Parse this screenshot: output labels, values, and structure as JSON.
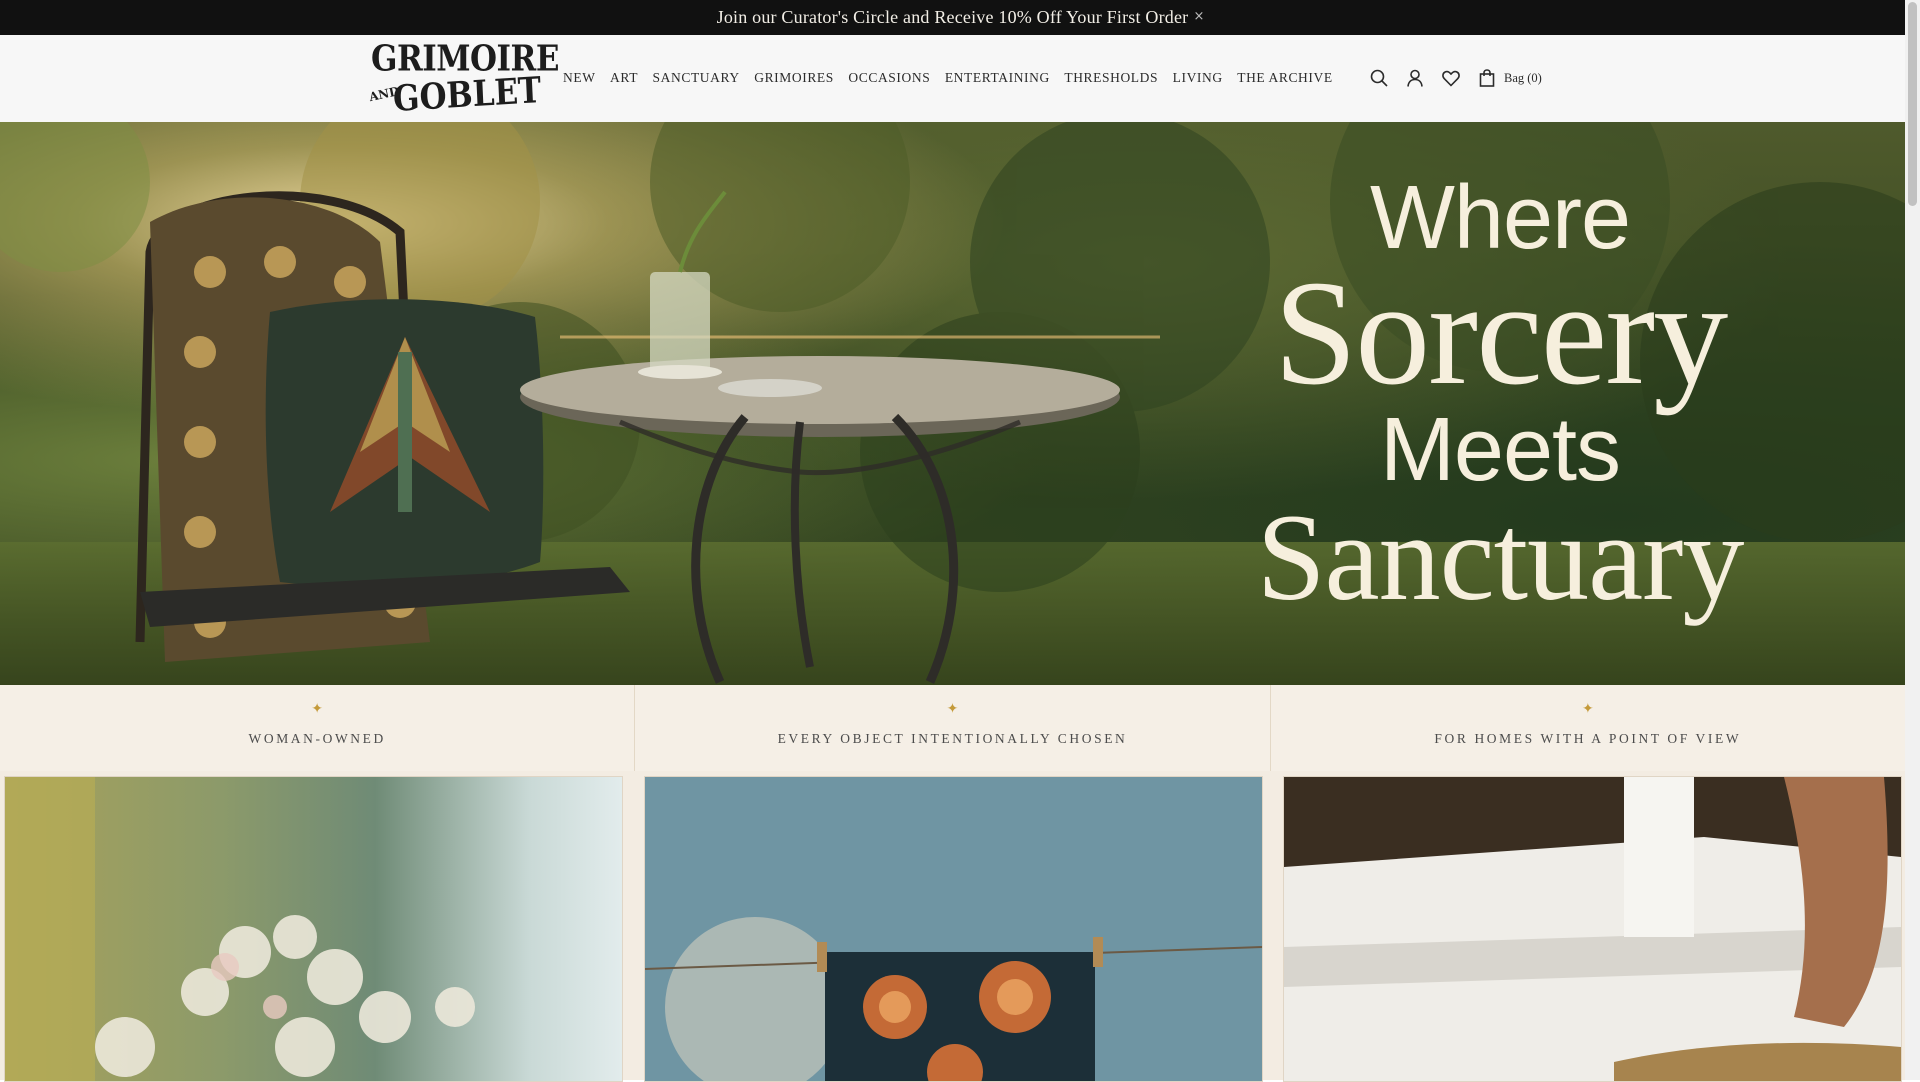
{
  "announcement": {
    "text": "Join our Curator's Circle and Receive 10% Off Your First Order",
    "close_symbol": "×"
  },
  "brand": {
    "line1": "GRIMOIRE",
    "and": "AND",
    "line2": "GOBLET"
  },
  "nav": {
    "items": [
      "NEW",
      "ART",
      "SANCTUARY",
      "GRIMOIRES",
      "OCCASIONS",
      "ENTERTAINING",
      "THRESHOLDS",
      "LIVING",
      "THE ARCHIVE"
    ]
  },
  "header_icons": [
    "search-icon",
    "account-icon",
    "wishlist-heart-icon",
    "bag-icon"
  ],
  "bag": {
    "label": "Bag (0)"
  },
  "hero": {
    "line1": "Where",
    "line2": "Sorcery",
    "line3": "Meets",
    "line4": "Sanctuary"
  },
  "values": [
    {
      "icon": "✦",
      "text": "WOMAN-OWNED"
    },
    {
      "icon": "✦",
      "text": "EVERY OBJECT INTENTIONALLY CHOSEN"
    },
    {
      "icon": "✦",
      "text": "FOR HOMES WITH A POINT OF VIEW"
    }
  ],
  "colors": {
    "announcement_bg": "#111111",
    "header_bg": "#f7f7f7",
    "values_bg": "#f5efe6",
    "accent_gold": "#c49a3a",
    "hero_text": "#f6efdd"
  }
}
